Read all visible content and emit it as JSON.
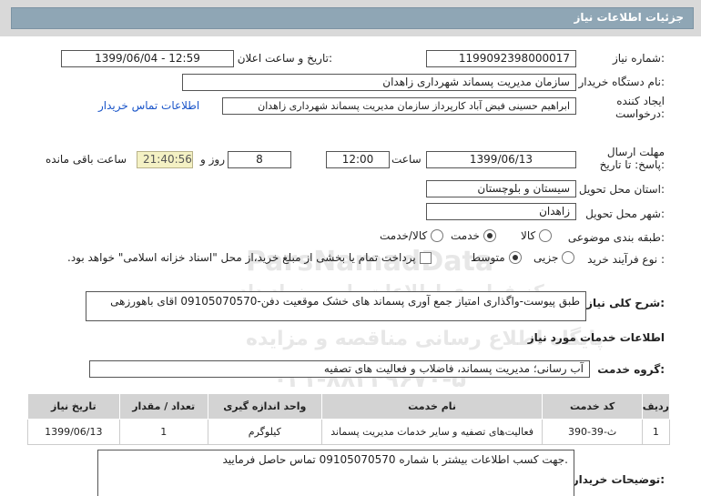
{
  "header": {
    "title": "جزئیات اطلاعات نیاز"
  },
  "fields": {
    "need_number_label": "شماره نیاز:",
    "need_number": "1199092398000017",
    "announce_label": "تاریخ و ساعت اعلان عمومی:",
    "announce_value": "1399/06/04 - 12:59",
    "buyer_org_label": "نام دستگاه خریدار:",
    "buyer_org": "سازمان مدیریت پسماند شهرداری زاهدان",
    "creator_label": "ایجاد کننده درخواست:",
    "creator": "ابراهیم حسینی فیض آباد کارپرداز سازمان مدیریت پسماند شهرداری زاهدان",
    "contact_link": "اطلاعات تماس خریدار",
    "deadline_label": "مهلت ارسال پاسخ: تا تاریخ:",
    "deadline_date": "1399/06/13",
    "time_label": "ساعت",
    "deadline_time": "12:00",
    "days_value": "8",
    "days_label": "روز و",
    "remaining_time": "21:40:56",
    "remaining_label": "ساعت باقی مانده",
    "province_label": "استان محل تحویل:",
    "province": "سیستان و بلوچستان",
    "city_label": "شهر محل تحویل:",
    "city": "زاهدان",
    "category_label": "طبقه بندی موضوعی:",
    "category_options": [
      "کالا",
      "خدمت",
      "کالا/خدمت"
    ],
    "purchase_label": "نوع فرآیند خرید :",
    "purchase_options": [
      "جزیی",
      "متوسط"
    ],
    "purchase_note": "پرداخت تمام یا بخشی از مبلغ خرید،از محل \"اسناد خزانه اسلامی\" خواهد بود."
  },
  "description": {
    "label": "شرح کلی نیاز:",
    "text": "طبق پیوست-واگذاری امتیاز جمع آوری پسماند های خشک موقعیت دفن-09105070570 اقای باهورزهی"
  },
  "services": {
    "section_title": "اطلاعات خدمات مورد نیاز",
    "group_label": "گروه خدمت:",
    "group_value": "آب رسانی؛ مدیریت پسماند، فاضلاب و فعالیت های تصفیه",
    "columns": [
      "ردیف",
      "کد خدمت",
      "نام خدمت",
      "واحد اندازه گیری",
      "تعداد / مقدار",
      "تاریخ نیاز"
    ],
    "rows": [
      [
        "1",
        "ث-39-390",
        "فعالیت‌های تصفیه و سایر خدمات مدیریت پسماند",
        "کیلوگرم",
        "1",
        "1399/06/13"
      ]
    ]
  },
  "buyer_notes": {
    "label": "توضیحات خریدار:",
    "text": "جهت کسب اطلاعات بیشتر با شماره 09105070570 تماس حاصل فرمایید."
  },
  "watermark": {
    "line1": "ParsNamadData",
    "line2": "مرکز فراوری اطلاعات پارس نماد داده",
    "line3": "پایگاه اطلاع رسانی مناقصه و مزایده",
    "line4": "۰۲۱-۸۸۳۴۹۶۷۰-۵"
  }
}
